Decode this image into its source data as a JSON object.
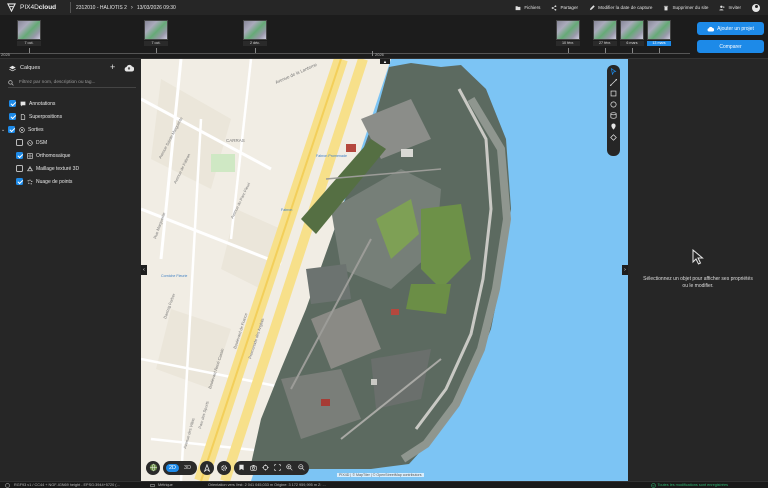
{
  "app": {
    "logo_text_light": "PIX4D",
    "logo_text_bold": "cloud"
  },
  "breadcrumb": {
    "project": "2312010 - HALIOTIS 2",
    "date": "13/03/2026 09:30"
  },
  "top_actions": {
    "files": "Fichiers",
    "share": "Partager",
    "edit_capture_date": "Modifier la date de capture",
    "delete_site": "Supprimer du site",
    "invite": "Inviter"
  },
  "timeline": {
    "year_2025": "2025",
    "year_2026": "2026",
    "thumbs": [
      "7 oct.",
      "7 oct.",
      "2 déc.",
      "10 févr.",
      "27 févr.",
      "6 mars",
      "13 mars"
    ]
  },
  "buttons": {
    "add_project": "Ajouter un projet",
    "compare": "Comparer"
  },
  "layers": {
    "title": "Calques",
    "search_placeholder": "Filtrez par nom, description ou tag...",
    "annotations": "Annotations",
    "overlays": "Superpositions",
    "outputs": "Sorties",
    "dsm": "DSM",
    "ortho": "Orthomosaïque",
    "mesh": "Maillage texturé 3D",
    "pointcloud": "Nuage de points"
  },
  "map": {
    "mode_2d": "2D",
    "mode_3d": "3D",
    "attribution": "PIX4D  |  © MapTiler  |  © OpenStreetMap contributors",
    "labels": {
      "avenue_lanterne": "Avenue de la Lanterne",
      "carras": "CARRAS",
      "avenue_sainte_marguerite": "Avenue Sainte-Marguerite",
      "avenue_fabron": "Avenue de Fabron",
      "avenue_parc_fleuri": "Avenue du Parc Fleuri",
      "fabron_promenade": "Fabron Promenade",
      "fabron": "Fabron",
      "rue_marguerite": "Rue Marguerite",
      "corniche_fleurie": "Corniche Fleurie",
      "promenade_anglais": "Promenade des Anglais",
      "boulevard_france": "Boulevard de France",
      "boulevard_rene_cassin": "Boulevard René Cassin",
      "dantzig_ferber": "Dantzig Ferber",
      "avenue_villas": "Avenue des Villas",
      "parc_des_sports": "Parc des Sports"
    }
  },
  "right_panel": {
    "message": "Sélectionnez un objet pour afficher ses propriétés ou le modifier."
  },
  "statusbar": {
    "crs": "RGF93 v1 / CC44 + NGF-IGN69 height - EPSG:3944+5720 (...",
    "units": "Métrique",
    "orientation": "Orientation vers l'est: 2 041 045,033 m  Origine: 3 172 959,995 m  Z: ...",
    "saved": "Toutes les modifications sont enregistrées"
  },
  "colors": {
    "accent": "#1d8ae8",
    "sea": "#7cc4f4",
    "ok": "#2eb872"
  }
}
